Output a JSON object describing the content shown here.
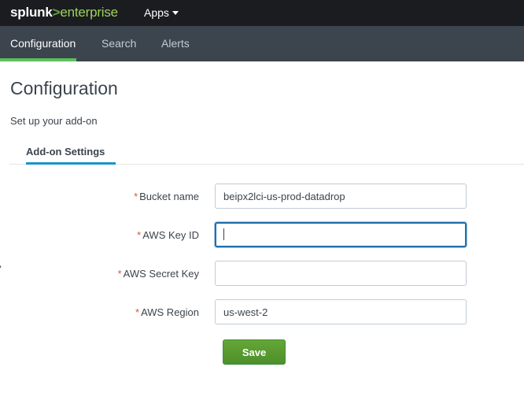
{
  "topbar": {
    "logo_part1": "splunk",
    "logo_part2": ">",
    "logo_part3": "enterprise",
    "apps_label": "Apps"
  },
  "navbar": {
    "items": [
      {
        "label": "Configuration",
        "active": true
      },
      {
        "label": "Search",
        "active": false
      },
      {
        "label": "Alerts",
        "active": false
      }
    ]
  },
  "page": {
    "title": "Configuration",
    "subtitle": "Set up your add-on"
  },
  "tabs": {
    "active_label": "Add-on Settings"
  },
  "form": {
    "required_mark": "*",
    "fields": [
      {
        "label": "Bucket name",
        "value": "beipx2lci-us-prod-datadrop",
        "required": true
      },
      {
        "label": "AWS Key ID",
        "value": "",
        "required": true,
        "focused": true
      },
      {
        "label": "AWS Secret Key",
        "value": "",
        "required": true
      },
      {
        "label": "AWS Region",
        "value": "us-west-2",
        "required": true
      }
    ],
    "save_label": "Save"
  },
  "colors": {
    "topbar_bg": "#1a1c20",
    "navbar_bg": "#3c444d",
    "nav_active_underline": "#5cc05c",
    "tab_underline": "#1e93c6",
    "focus_border": "#1f6ea8",
    "required_mark": "#d6563c",
    "save_button": "#65a637"
  },
  "icons": {
    "apps_caret": "caret-down-icon",
    "edge_arrow": "chevron-right-icon"
  }
}
